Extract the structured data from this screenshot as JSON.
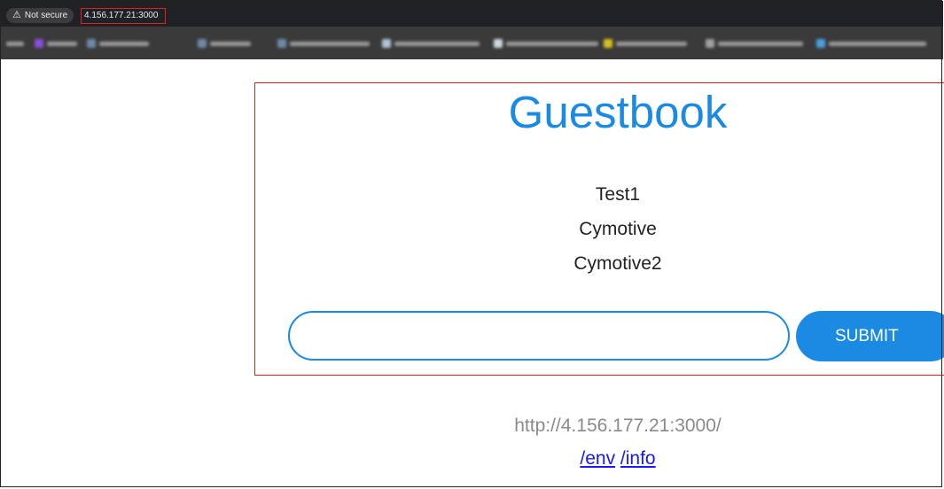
{
  "browser": {
    "security_label": "Not secure",
    "security_icon": "warning-triangle-icon",
    "url": "4.156.177.21:3000"
  },
  "bookmarks": [
    {
      "icon_color": "#8a4fd8"
    },
    {
      "icon_color": "#6d8aa8"
    },
    {
      "icon_color": "#6d8aa8"
    },
    {
      "icon_color": "#6d8aa8"
    },
    {
      "icon_color": "#b0c4d8"
    },
    {
      "icon_color": "#cfd8e0"
    },
    {
      "icon_color": "#d8c020"
    },
    {
      "icon_color": "#a0a0a0"
    },
    {
      "icon_color": "#4aa0e0"
    }
  ],
  "page": {
    "title": "Guestbook",
    "entries": [
      "Test1",
      "Cymotive",
      "Cymotive2"
    ],
    "input_value": "",
    "submit_label": "SUBMIT",
    "footer_url": "http://4.156.177.21:3000/",
    "links": {
      "env": "/env",
      "info": "/info"
    }
  },
  "colors": {
    "accent": "#1a8ae2",
    "highlight_border": "#e02020",
    "link": "#1a1aee"
  }
}
